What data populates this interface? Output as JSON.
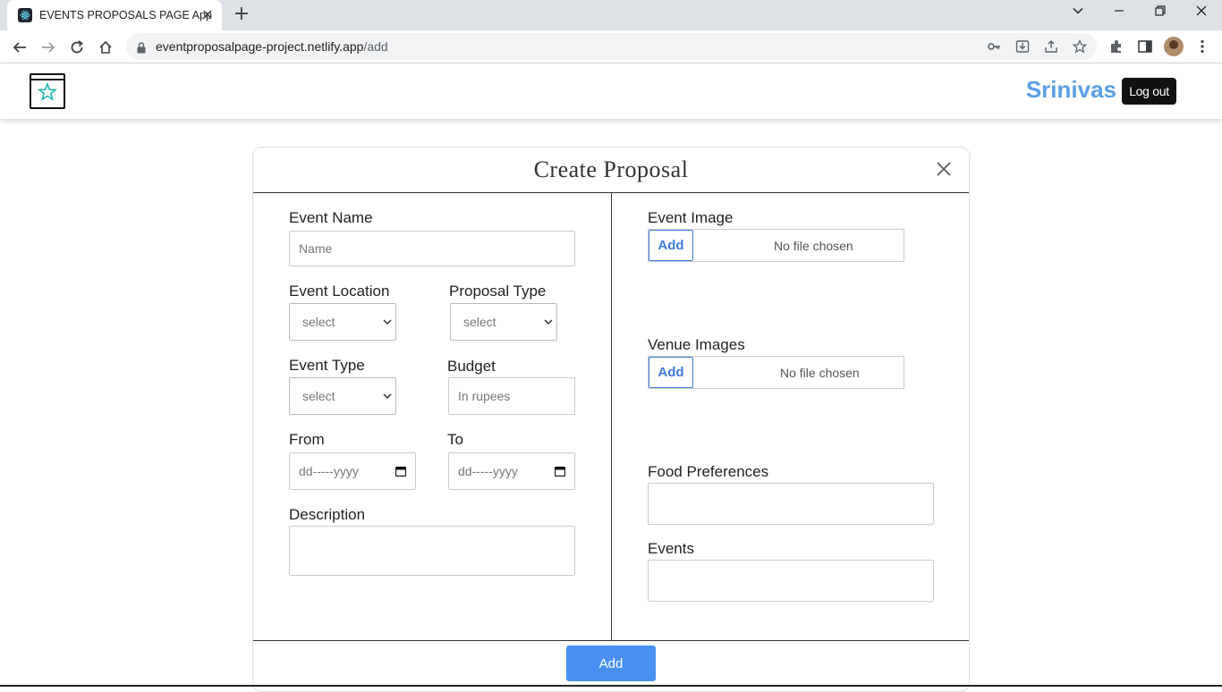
{
  "browser": {
    "tab_title": "EVENTS PROPOSALS PAGE App",
    "url_domain": "eventproposalpage-project.netlify.app",
    "url_path": "/add"
  },
  "header": {
    "username": "Srinivas",
    "logout_label": "Log out"
  },
  "modal": {
    "title": "Create Proposal",
    "left": {
      "event_name_label": "Event Name",
      "event_name_placeholder": "Name",
      "event_location_label": "Event Location",
      "event_location_value": "select",
      "proposal_type_label": "Proposal Type",
      "proposal_type_value": "select",
      "event_type_label": "Event Type",
      "event_type_value": "select",
      "budget_label": "Budget",
      "budget_placeholder": "In rupees",
      "from_label": "From",
      "from_placeholder": "dd-----yyyy",
      "to_label": "To",
      "to_placeholder": "dd-----yyyy",
      "description_label": "Description"
    },
    "right": {
      "event_image_label": "Event Image",
      "event_image_button": "Add",
      "event_image_status": "No file chosen",
      "venue_images_label": "Venue Images",
      "venue_images_button": "Add",
      "venue_images_status": "No file chosen",
      "food_preferences_label": "Food Preferences",
      "events_label": "Events"
    },
    "submit_label": "Add"
  },
  "colors": {
    "brand_name": "#5aa0e6",
    "primary_button": "#4a90f0",
    "file_button": "#3d7bd9"
  }
}
